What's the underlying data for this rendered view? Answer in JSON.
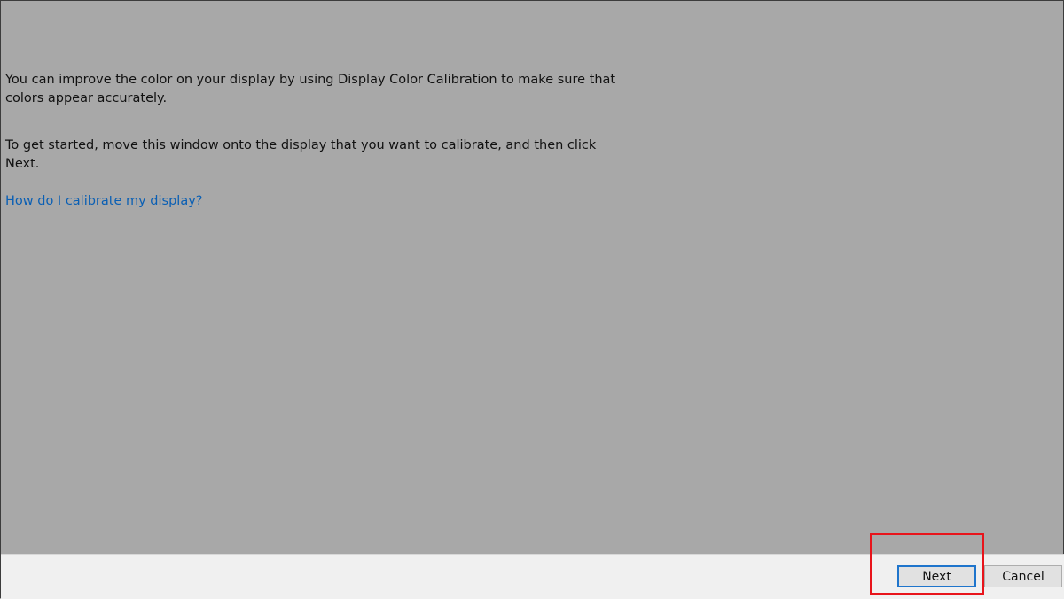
{
  "intro": {
    "paragraph1": "You can improve the color on your display by using Display Color Calibration to make sure that colors appear accurately.",
    "paragraph2": "To get started, move this window onto the display that you want to calibrate, and then click Next.",
    "help_link": "How do I calibrate my display?"
  },
  "footer": {
    "next_label": "Next",
    "cancel_label": "Cancel"
  },
  "colors": {
    "background": "#a8a8a8",
    "footer": "#f0f0f0",
    "link": "#0a5fb4",
    "focus_border": "#1f75cc",
    "annotation": "#e8141b"
  }
}
